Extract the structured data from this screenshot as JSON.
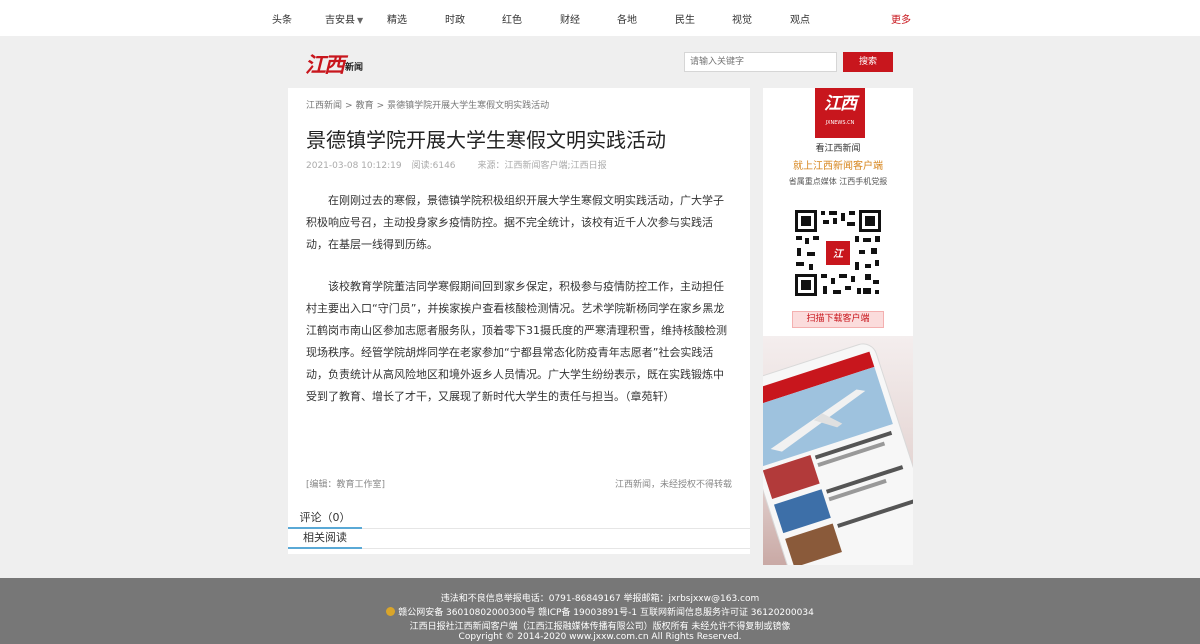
{
  "nav": {
    "items": [
      "头条",
      "吉安县",
      "精选",
      "时政",
      "红色",
      "财经",
      "各地",
      "民生",
      "视觉",
      "观点"
    ],
    "more": "更多"
  },
  "header": {
    "logo_big": "江西",
    "logo_small": "新闻",
    "search_placeholder": "请输入关键字",
    "search_button": "搜索"
  },
  "article": {
    "breadcrumb": [
      "江西新闻",
      "教育",
      "景德镇学院开展大学生寒假文明实践活动"
    ],
    "breadcrumb_sep": ">",
    "title": "景德镇学院开展大学生寒假文明实践活动",
    "date": "2021-03-08 10:12:19",
    "views": "阅读:6146",
    "source": "来源：江西新闻客户端;江西日报",
    "paragraphs": [
      "在刚刚过去的寒假，景德镇学院积极组织开展大学生寒假文明实践活动，广大学子积极响应号召，主动投身家乡疫情防控。据不完全统计，该校有近千人次参与实践活动，在基层一线得到历练。",
      "该校教育学院董洁同学寒假期间回到家乡保定，积极参与疫情防控工作，主动担任村主要出入口“守门员”，并挨家挨户查看核酸检测情况。艺术学院靳杨同学在家乡黑龙江鹤岗市南山区参加志愿者服务队，顶着零下31摄氏度的严寒清理积雪，维持核酸检测现场秩序。经管学院胡烨同学在老家参加“宁都县常态化防疫青年志愿者”社会实践活动，负责统计从高风险地区和境外返乡人员情况。广大学生纷纷表示，既在实践锻炼中受到了教育、增长了才干，又展现了新时代大学生的责任与担当。（章苑轩）"
    ],
    "editor": "[编辑：教育工作室]",
    "rights": "江西新闻，未经授权不得转载",
    "comment_tab": "评论（0）",
    "related_tab": "相关阅读"
  },
  "sidebar": {
    "app_glyph": "江西",
    "app_url": "JXNEWS.CN",
    "caption1": "看江西新闻",
    "caption2": "就上江西新闻客户端",
    "caption3": "省属重点媒体 江西手机党报",
    "download_button": "扫描下载客户端"
  },
  "footer": {
    "line1": "违法和不良信息举报电话：0791-86849167  举报邮箱：jxrbsjxxw@163.com",
    "line2": "赣公网安备 36010802000300号       赣ICP备 19003891号-1  互联网新闻信息服务许可证 36120200034",
    "line3": "江西日报社江西新闻客户端（江西江报融媒体传播有限公司）版权所有 未经允许不得复制或镜像",
    "line4": "Copyright © 2014-2020 www.jxxw.com.cn All Rights Reserved."
  },
  "colors": {
    "brand": "#c8161d",
    "accent": "#5aa9d6",
    "footer": "#777777"
  }
}
